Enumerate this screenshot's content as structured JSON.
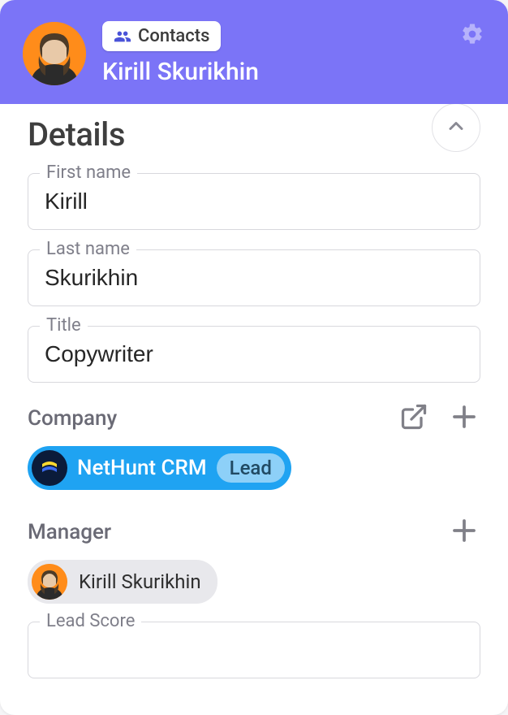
{
  "header": {
    "badge_label": "Contacts",
    "contact_name": "Kirill Skurikhin"
  },
  "details": {
    "section_title": "Details",
    "fields": {
      "first_name": {
        "label": "First name",
        "value": "Kirill"
      },
      "last_name": {
        "label": "Last name",
        "value": "Skurikhin"
      },
      "title": {
        "label": "Title",
        "value": "Copywriter"
      },
      "lead_score": {
        "label": "Lead Score",
        "value": ""
      }
    },
    "company": {
      "label": "Company",
      "name": "NetHunt CRM",
      "status": "Lead"
    },
    "manager": {
      "label": "Manager",
      "name": "Kirill Skurikhin"
    }
  }
}
